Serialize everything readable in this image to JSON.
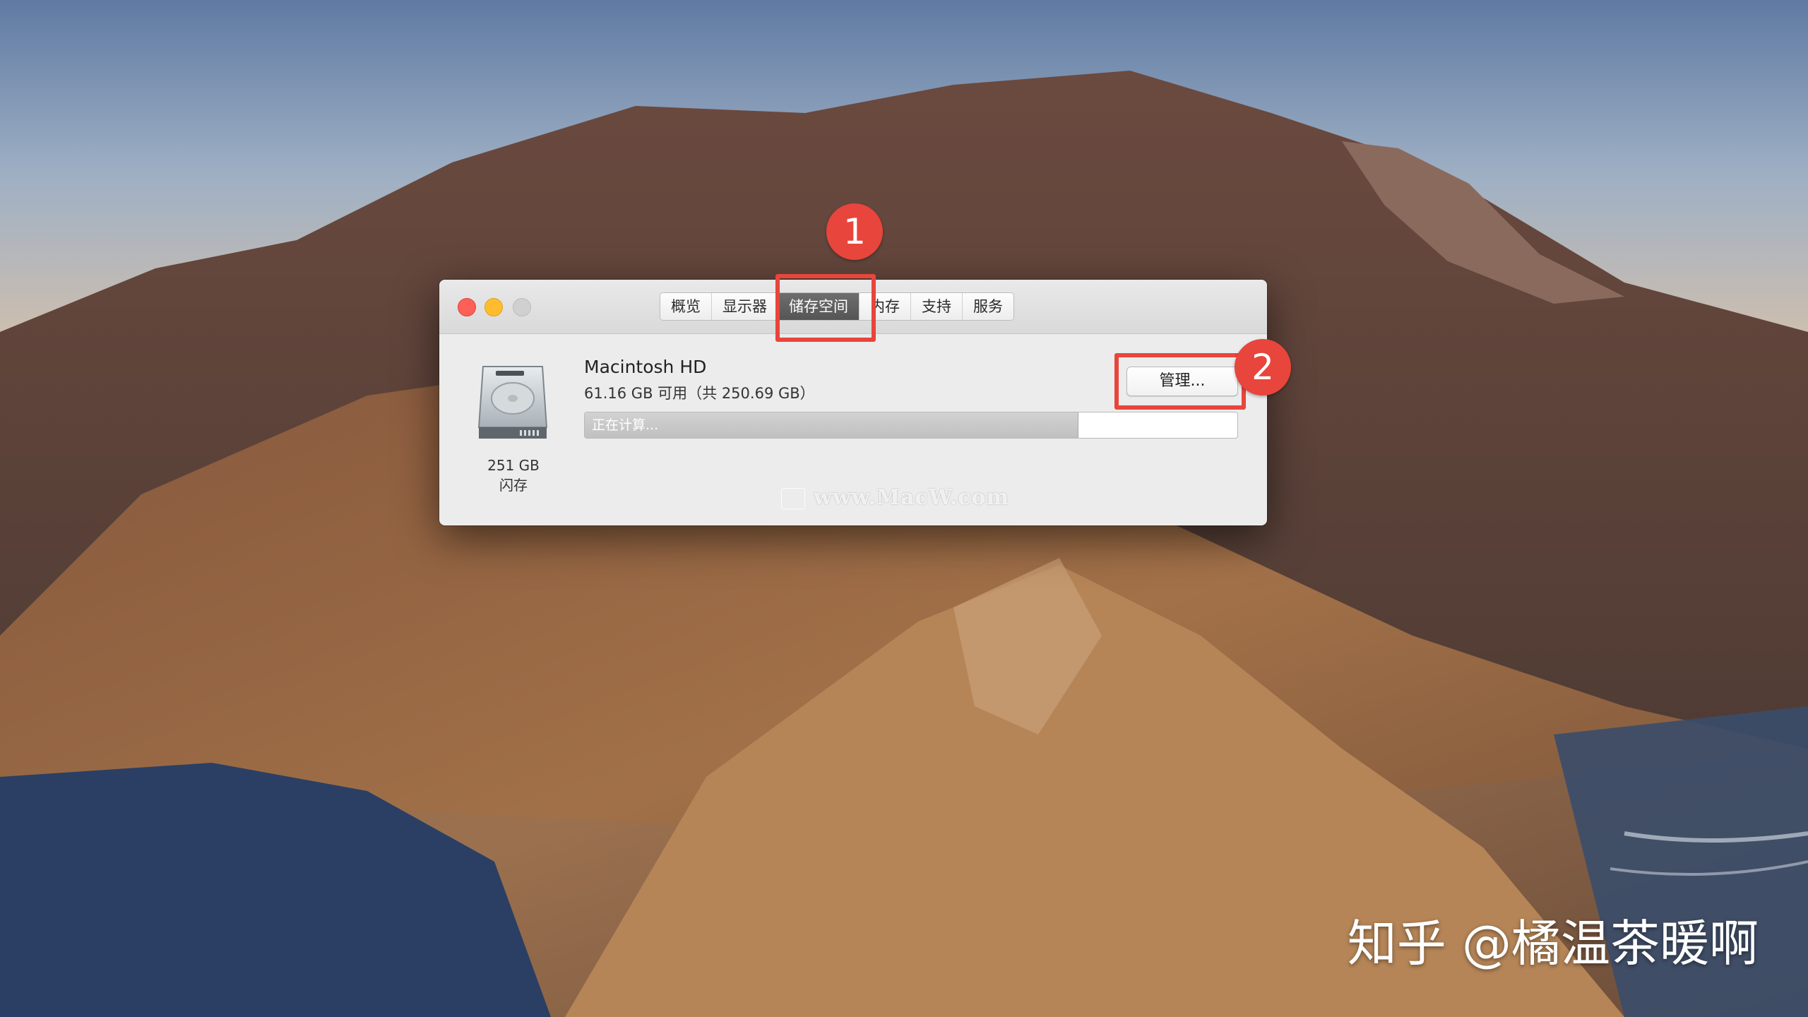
{
  "window": {
    "tabs": [
      {
        "label": "概览"
      },
      {
        "label": "显示器"
      },
      {
        "label": "储存空间",
        "active": true
      },
      {
        "label": "内存"
      },
      {
        "label": "支持"
      },
      {
        "label": "服务"
      }
    ]
  },
  "storage": {
    "disk_name": "Macintosh HD",
    "availability": "61.16 GB 可用（共 250.69 GB）",
    "capacity_label": "251 GB",
    "media_type": "闪存",
    "status_text": "正在计算...",
    "used_fraction": 0.756,
    "manage_label": "管理..."
  },
  "annotations": {
    "step_1": "1",
    "step_2": "2",
    "color": "#e8453c"
  },
  "overlay": {
    "site_watermark": "www.MacW.com",
    "credit": "知乎 @橘温茶暖啊"
  }
}
